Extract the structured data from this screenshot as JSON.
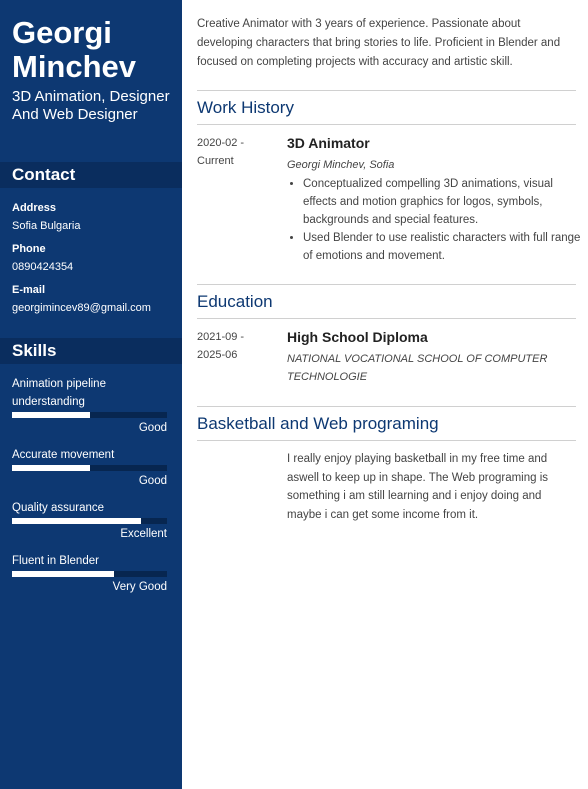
{
  "profile": {
    "first_name": "Georgi",
    "last_name": "Minchev",
    "title": "3D Animation, Designer And Web Designer"
  },
  "contact": {
    "heading": "Contact",
    "address_label": "Address",
    "address": "Sofia Bulgaria",
    "phone_label": "Phone",
    "phone": "0890424354",
    "email_label": "E-mail",
    "email": "georgimincev89@gmail.com"
  },
  "skills": {
    "heading": "Skills",
    "items": [
      {
        "name": "Animation pipeline understanding",
        "level": "Good",
        "fill": 0.5
      },
      {
        "name": "Accurate movement",
        "level": "Good",
        "fill": 0.5
      },
      {
        "name": "Quality assurance",
        "level": "Excellent",
        "fill": 0.83
      },
      {
        "name": "Fluent in Blender",
        "level": "Very Good",
        "fill": 0.66
      }
    ]
  },
  "summary": "Creative Animator with 3 years of experience. Passionate about developing characters that bring stories to life. Proficient in Blender and focused on completing projects with accuracy and artistic skill.",
  "work": {
    "heading": "Work History",
    "date_start": "2020-02 -",
    "date_end": "Current",
    "title": "3D Animator",
    "company": "Georgi Minchev, Sofia",
    "bullets": [
      "Conceptualized compelling 3D animations, visual effects and motion graphics for logos, symbols, backgrounds and special features.",
      "Used Blender to use realistic characters with full range of emotions and movement."
    ]
  },
  "education": {
    "heading": "Education",
    "date_start": "2021-09 -",
    "date_end": "2025-06",
    "degree": "High School Diploma",
    "school": "NATIONAL VOCATIONAL SCHOOL OF COMPUTER TECHNOLOGIE"
  },
  "hobby": {
    "heading": "Basketball and Web programing",
    "text": "I really enjoy playing basketball in my free time and aswell to keep up in shape. The Web programing is something i am still learning and i enjoy doing and maybe i can get some income from it."
  }
}
